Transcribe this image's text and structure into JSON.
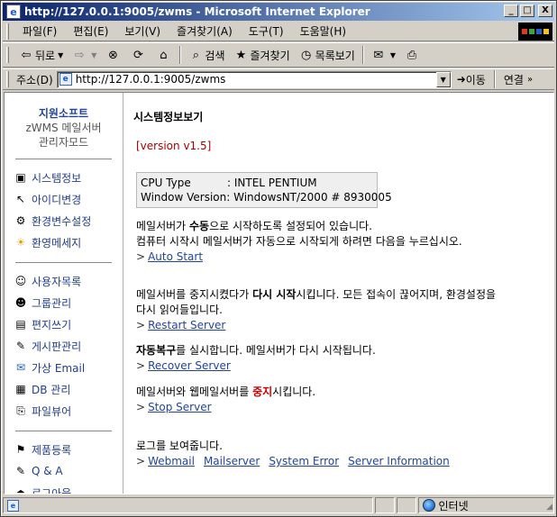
{
  "window": {
    "title": "http://127.0.0.1:9005/zwms - Microsoft Internet Explorer",
    "min_label": "_",
    "max_label": "□",
    "close_label": "X"
  },
  "menu": [
    "파일(F)",
    "편집(E)",
    "보기(V)",
    "즐겨찾기(A)",
    "도구(T)",
    "도움말(H)"
  ],
  "toolbar": {
    "back": "뒤로",
    "search": "검색",
    "favorites": "즐겨찾기",
    "history": "목록보기"
  },
  "address": {
    "label": "주소(D)",
    "url": "http://127.0.0.1:9005/zwms",
    "go": "이동",
    "links": "연결"
  },
  "sidebar": {
    "brand1": "지원소프트",
    "brand2": "zWMS 메일서버",
    "brand3": "관리자모드",
    "group1": [
      "시스템정보",
      "아이디변경",
      "환경변수설정",
      "환영메세지"
    ],
    "group2": [
      "사용자목록",
      "그룹관리",
      "편지쓰기",
      "게시판관리",
      "가상 Email",
      "DB 관리",
      "파일뷰어"
    ],
    "group3": [
      "제품등록",
      "Q & A",
      "로그아웃"
    ]
  },
  "main": {
    "heading": "시스템정보보기",
    "version": "[version v1.5]",
    "info": {
      "cpu_key": "CPU Type",
      "cpu_val": ": INTEL PENTIUM",
      "win_key": "Window Version",
      "win_val": ": WindowsNT/2000 # 8930005"
    },
    "auto": {
      "p1_pre": "메일서버가 ",
      "p1_bold": "수동",
      "p1_post": "으로 시작하도록 설정되어 있습니다.",
      "p2": "컴퓨터 시작시 메일서버가 자동으로 시작되게 하려면 다음을 누르십시오.",
      "link": "Auto Start"
    },
    "restart": {
      "p1_pre": "메일서버를 중지시켰다가 ",
      "p1_bold": "다시 시작",
      "p1_post": "시킵니다. 모든 접속이 끊어지며, 환경설정을",
      "p2": "다시 읽어들입니다.",
      "link": "Restart Server"
    },
    "recover": {
      "p1_bold": "자동복구",
      "p1_post": "를 실시합니다. 메일서버가 다시 시작됩니다.",
      "link": "Recover Server"
    },
    "stop": {
      "p1_pre": "메일서버와 웹메일서버를 ",
      "p1_red": "중지",
      "p1_post": "시킵니다.",
      "link": "Stop Server"
    },
    "logs": {
      "p1": "로그를 보여줍니다.",
      "links": [
        "Webmail",
        "Mailserver",
        "System Error",
        "Server Information"
      ]
    },
    "arrow": ">"
  },
  "status": {
    "zone": "인터넷"
  }
}
